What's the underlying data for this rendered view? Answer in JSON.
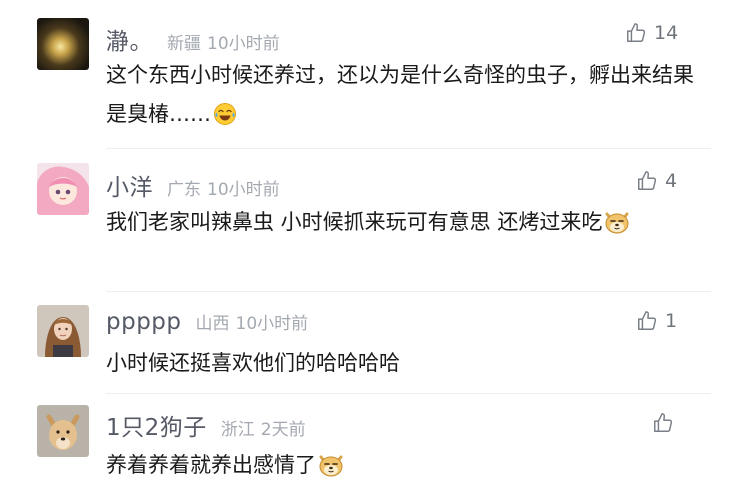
{
  "comments": [
    {
      "username": "瀞。",
      "location": "新疆",
      "time": "10小时前",
      "likes": "14",
      "text": "这个东西小时候还养过，还以为是什么奇怪的虫子，孵出来结果是臭椿……",
      "trailing_emoji": "laugh-cry-emoji-icon"
    },
    {
      "username": "小洋",
      "location": "广东",
      "time": "10小时前",
      "likes": "4",
      "text": "我们老家叫辣鼻虫 小时候抓来玩可有意思 还烤过来吃",
      "trailing_emoji": "doge-emoji-icon"
    },
    {
      "username": "ppppp",
      "location": "山西",
      "time": "10小时前",
      "likes": "1",
      "text": "小时候还挺喜欢他们的哈哈哈哈",
      "trailing_emoji": ""
    },
    {
      "username": "1只2狗子",
      "location": "浙江",
      "time": "2天前",
      "likes": "",
      "text": "养着养着就养出感情了",
      "trailing_emoji": "doge-emoji-icon"
    }
  ],
  "colors": {
    "username": "#555a66",
    "meta": "#a4a9b1",
    "body_text": "#1a1a1a",
    "icon": "#7a7f87"
  }
}
